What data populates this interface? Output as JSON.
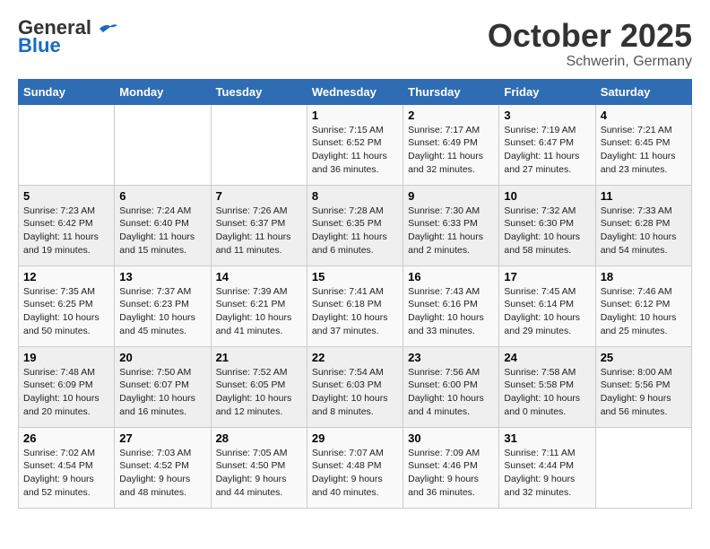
{
  "header": {
    "logo_general": "General",
    "logo_blue": "Blue",
    "month": "October 2025",
    "location": "Schwerin, Germany"
  },
  "days_of_week": [
    "Sunday",
    "Monday",
    "Tuesday",
    "Wednesday",
    "Thursday",
    "Friday",
    "Saturday"
  ],
  "weeks": [
    [
      {
        "day": "",
        "info": ""
      },
      {
        "day": "",
        "info": ""
      },
      {
        "day": "",
        "info": ""
      },
      {
        "day": "1",
        "info": "Sunrise: 7:15 AM\nSunset: 6:52 PM\nDaylight: 11 hours\nand 36 minutes."
      },
      {
        "day": "2",
        "info": "Sunrise: 7:17 AM\nSunset: 6:49 PM\nDaylight: 11 hours\nand 32 minutes."
      },
      {
        "day": "3",
        "info": "Sunrise: 7:19 AM\nSunset: 6:47 PM\nDaylight: 11 hours\nand 27 minutes."
      },
      {
        "day": "4",
        "info": "Sunrise: 7:21 AM\nSunset: 6:45 PM\nDaylight: 11 hours\nand 23 minutes."
      }
    ],
    [
      {
        "day": "5",
        "info": "Sunrise: 7:23 AM\nSunset: 6:42 PM\nDaylight: 11 hours\nand 19 minutes."
      },
      {
        "day": "6",
        "info": "Sunrise: 7:24 AM\nSunset: 6:40 PM\nDaylight: 11 hours\nand 15 minutes."
      },
      {
        "day": "7",
        "info": "Sunrise: 7:26 AM\nSunset: 6:37 PM\nDaylight: 11 hours\nand 11 minutes."
      },
      {
        "day": "8",
        "info": "Sunrise: 7:28 AM\nSunset: 6:35 PM\nDaylight: 11 hours\nand 6 minutes."
      },
      {
        "day": "9",
        "info": "Sunrise: 7:30 AM\nSunset: 6:33 PM\nDaylight: 11 hours\nand 2 minutes."
      },
      {
        "day": "10",
        "info": "Sunrise: 7:32 AM\nSunset: 6:30 PM\nDaylight: 10 hours\nand 58 minutes."
      },
      {
        "day": "11",
        "info": "Sunrise: 7:33 AM\nSunset: 6:28 PM\nDaylight: 10 hours\nand 54 minutes."
      }
    ],
    [
      {
        "day": "12",
        "info": "Sunrise: 7:35 AM\nSunset: 6:25 PM\nDaylight: 10 hours\nand 50 minutes."
      },
      {
        "day": "13",
        "info": "Sunrise: 7:37 AM\nSunset: 6:23 PM\nDaylight: 10 hours\nand 45 minutes."
      },
      {
        "day": "14",
        "info": "Sunrise: 7:39 AM\nSunset: 6:21 PM\nDaylight: 10 hours\nand 41 minutes."
      },
      {
        "day": "15",
        "info": "Sunrise: 7:41 AM\nSunset: 6:18 PM\nDaylight: 10 hours\nand 37 minutes."
      },
      {
        "day": "16",
        "info": "Sunrise: 7:43 AM\nSunset: 6:16 PM\nDaylight: 10 hours\nand 33 minutes."
      },
      {
        "day": "17",
        "info": "Sunrise: 7:45 AM\nSunset: 6:14 PM\nDaylight: 10 hours\nand 29 minutes."
      },
      {
        "day": "18",
        "info": "Sunrise: 7:46 AM\nSunset: 6:12 PM\nDaylight: 10 hours\nand 25 minutes."
      }
    ],
    [
      {
        "day": "19",
        "info": "Sunrise: 7:48 AM\nSunset: 6:09 PM\nDaylight: 10 hours\nand 20 minutes."
      },
      {
        "day": "20",
        "info": "Sunrise: 7:50 AM\nSunset: 6:07 PM\nDaylight: 10 hours\nand 16 minutes."
      },
      {
        "day": "21",
        "info": "Sunrise: 7:52 AM\nSunset: 6:05 PM\nDaylight: 10 hours\nand 12 minutes."
      },
      {
        "day": "22",
        "info": "Sunrise: 7:54 AM\nSunset: 6:03 PM\nDaylight: 10 hours\nand 8 minutes."
      },
      {
        "day": "23",
        "info": "Sunrise: 7:56 AM\nSunset: 6:00 PM\nDaylight: 10 hours\nand 4 minutes."
      },
      {
        "day": "24",
        "info": "Sunrise: 7:58 AM\nSunset: 5:58 PM\nDaylight: 10 hours\nand 0 minutes."
      },
      {
        "day": "25",
        "info": "Sunrise: 8:00 AM\nSunset: 5:56 PM\nDaylight: 9 hours\nand 56 minutes."
      }
    ],
    [
      {
        "day": "26",
        "info": "Sunrise: 7:02 AM\nSunset: 4:54 PM\nDaylight: 9 hours\nand 52 minutes."
      },
      {
        "day": "27",
        "info": "Sunrise: 7:03 AM\nSunset: 4:52 PM\nDaylight: 9 hours\nand 48 minutes."
      },
      {
        "day": "28",
        "info": "Sunrise: 7:05 AM\nSunset: 4:50 PM\nDaylight: 9 hours\nand 44 minutes."
      },
      {
        "day": "29",
        "info": "Sunrise: 7:07 AM\nSunset: 4:48 PM\nDaylight: 9 hours\nand 40 minutes."
      },
      {
        "day": "30",
        "info": "Sunrise: 7:09 AM\nSunset: 4:46 PM\nDaylight: 9 hours\nand 36 minutes."
      },
      {
        "day": "31",
        "info": "Sunrise: 7:11 AM\nSunset: 4:44 PM\nDaylight: 9 hours\nand 32 minutes."
      },
      {
        "day": "",
        "info": ""
      }
    ]
  ]
}
